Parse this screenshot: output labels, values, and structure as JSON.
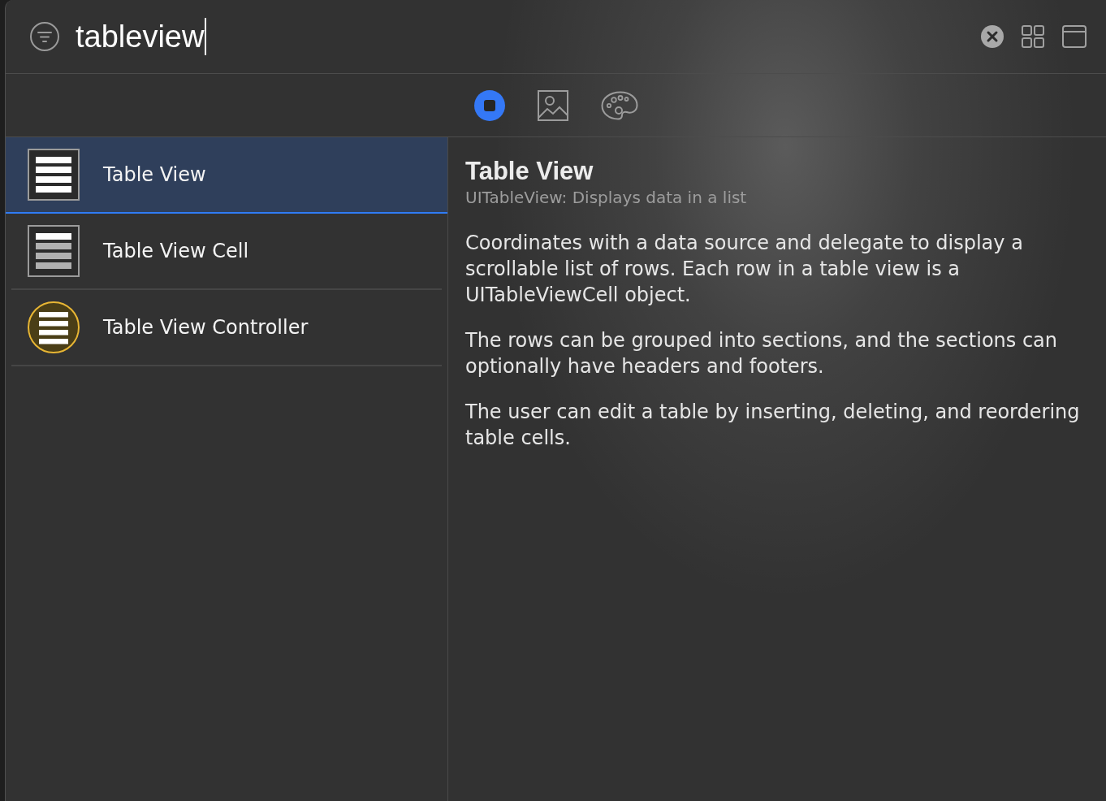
{
  "search": {
    "value": "tableview"
  },
  "library_tabs": [
    {
      "kind": "objects",
      "selected": true
    },
    {
      "kind": "media",
      "selected": false
    },
    {
      "kind": "colors",
      "selected": false
    }
  ],
  "results": [
    {
      "label": "Table View",
      "kind": "table",
      "selected": true
    },
    {
      "label": "Table View Cell",
      "kind": "cell",
      "selected": false
    },
    {
      "label": "Table View Controller",
      "kind": "controller",
      "selected": false
    }
  ],
  "detail": {
    "title": "Table View",
    "subtitle": "UITableView: Displays data in a list",
    "paragraphs": [
      "Coordinates with a data source and delegate to display a scrollable list of rows. Each row in a table view is a UITableViewCell object.",
      "The rows can be grouped into sections, and the sections can optionally have headers and footers.",
      "The user can edit a table by inserting, deleting, and reordering table cells."
    ]
  }
}
